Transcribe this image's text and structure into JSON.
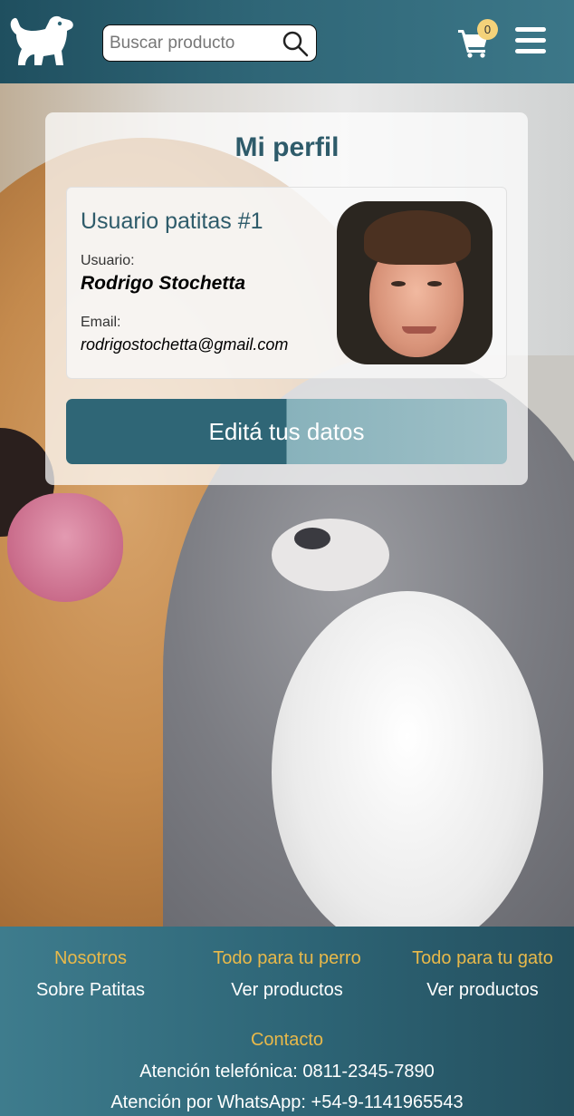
{
  "header": {
    "logo_icon": "dog-logo-icon",
    "search_placeholder": "Buscar producto",
    "search_icon": "search-icon",
    "cart_icon": "cart-icon",
    "cart_count": "0",
    "menu_icon": "hamburger-menu-icon"
  },
  "profile": {
    "title": "Mi perfil",
    "heading": "Usuario patitas #1",
    "user_label": "Usuario:",
    "user_name": "Rodrigo Stochetta",
    "email_label": "Email:",
    "email": "rodrigostochetta@gmail.com",
    "edit_button": "Editá tus datos"
  },
  "footer": {
    "columns": [
      {
        "heading": "Nosotros",
        "link": "Sobre Patitas"
      },
      {
        "heading": "Todo para tu perro",
        "link": "Ver productos"
      },
      {
        "heading": "Todo para tu gato",
        "link": "Ver productos"
      }
    ],
    "contact_heading": "Contacto",
    "phone": "Atención telefónica: 0811-2345-7890",
    "whatsapp": "Atención por WhatsApp: +54-9-1141965543"
  },
  "colors": {
    "header_bg": "#2f6677",
    "accent_text": "#2e5b6a",
    "footer_heading": "#e9b94a",
    "badge": "#f4d27a"
  }
}
